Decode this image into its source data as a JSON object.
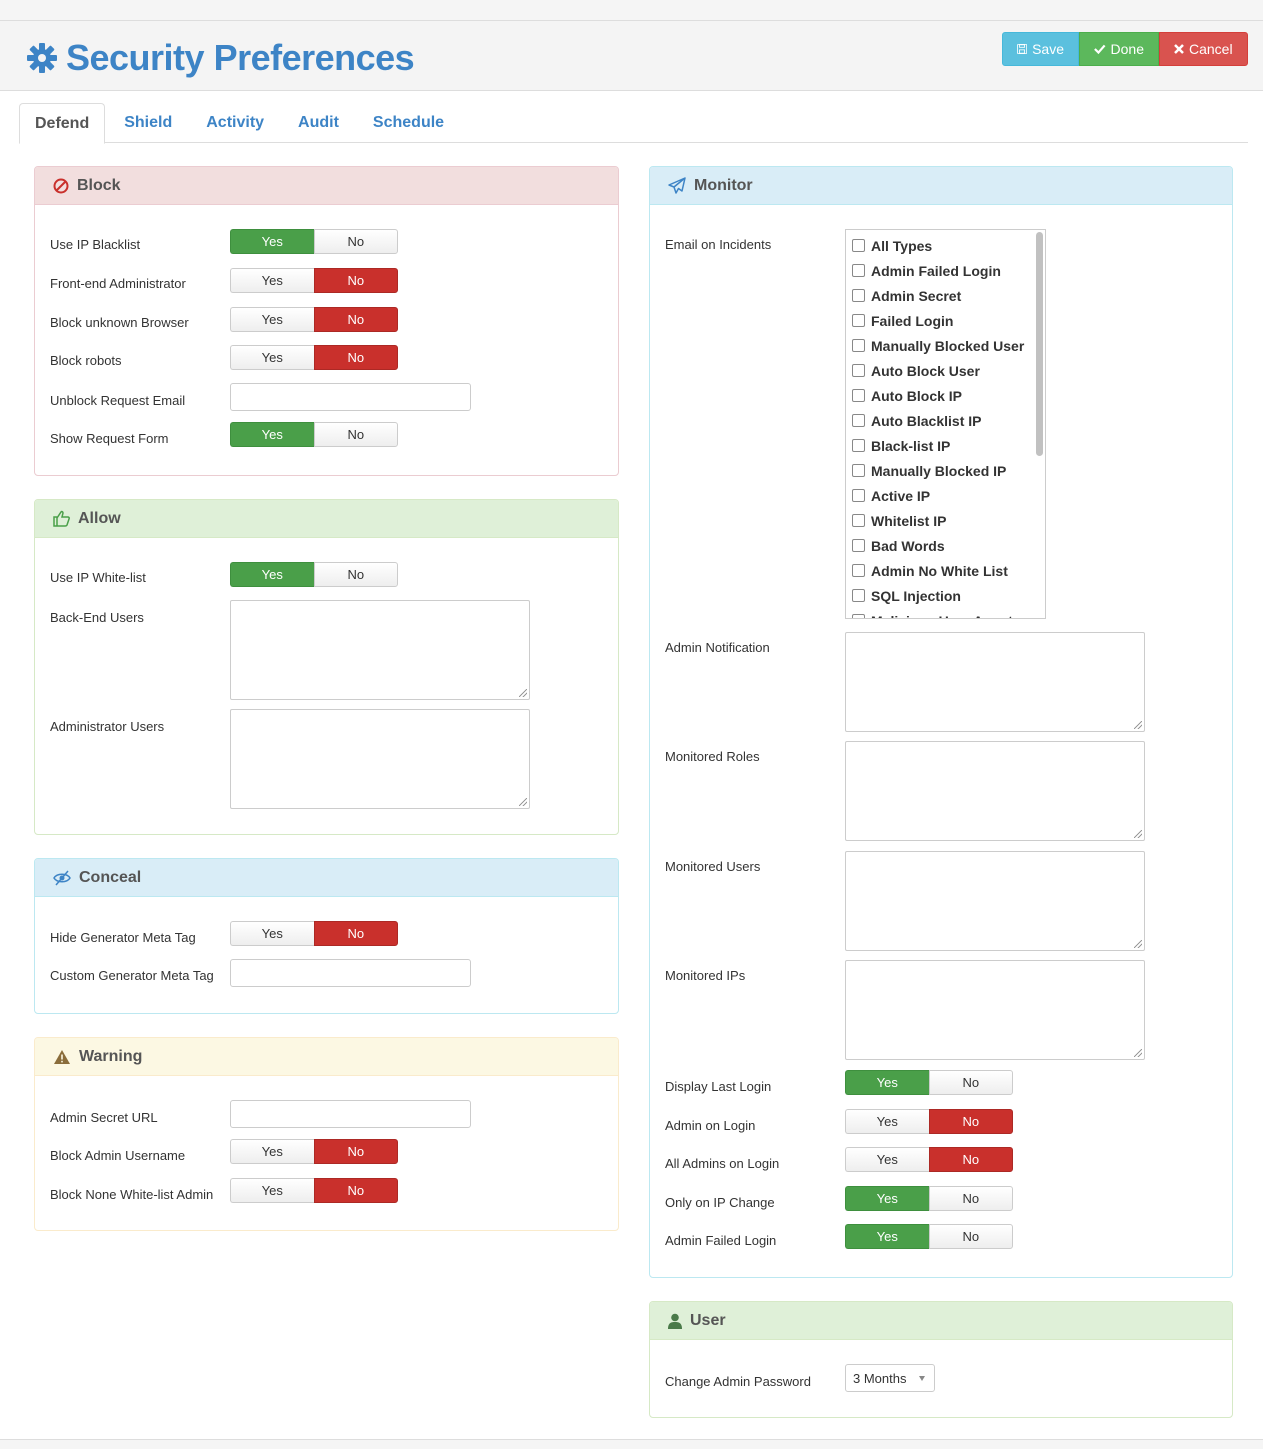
{
  "header": {
    "title": "Security Preferences",
    "save_label": "Save",
    "done_label": "Done",
    "cancel_label": "Cancel"
  },
  "tabs": [
    {
      "label": "Defend",
      "active": true
    },
    {
      "label": "Shield",
      "active": false
    },
    {
      "label": "Activity",
      "active": false
    },
    {
      "label": "Audit",
      "active": false
    },
    {
      "label": "Schedule",
      "active": false
    }
  ],
  "toggle_labels": {
    "yes": "Yes",
    "no": "No"
  },
  "block": {
    "title": "Block",
    "use_ip_blacklist": {
      "label": "Use IP Blacklist",
      "value": "Yes"
    },
    "frontend_admin": {
      "label": "Front-end Administrator",
      "value": "No"
    },
    "block_unknown_browser": {
      "label": "Block unknown Browser",
      "value": "No"
    },
    "block_robots": {
      "label": "Block robots",
      "value": "No"
    },
    "unblock_request_email": {
      "label": "Unblock Request Email",
      "value": ""
    },
    "show_request_form": {
      "label": "Show Request Form",
      "value": "Yes"
    }
  },
  "allow": {
    "title": "Allow",
    "use_ip_whitelist": {
      "label": "Use IP White-list",
      "value": "Yes"
    },
    "backend_users": {
      "label": "Back-End Users",
      "value": ""
    },
    "administrator_users": {
      "label": "Administrator Users",
      "value": ""
    }
  },
  "conceal": {
    "title": "Conceal",
    "hide_generator": {
      "label": "Hide Generator Meta Tag",
      "value": "No"
    },
    "custom_generator": {
      "label": "Custom Generator Meta Tag",
      "value": ""
    }
  },
  "warning": {
    "title": "Warning",
    "admin_secret_url": {
      "label": "Admin Secret URL",
      "value": ""
    },
    "block_admin_username": {
      "label": "Block Admin Username",
      "value": "No"
    },
    "block_none_whitelist_admin": {
      "label": "Block None White-list Admin",
      "value": "No"
    }
  },
  "monitor": {
    "title": "Monitor",
    "email_on_incidents": {
      "label": "Email on Incidents",
      "options": [
        "All Types",
        "Admin Failed Login",
        "Admin Secret",
        "Failed Login",
        "Manually Blocked User",
        "Auto Block User",
        "Auto Block IP",
        "Auto Blacklist IP",
        "Black-list IP",
        "Manually Blocked IP",
        "Active IP",
        "Whitelist IP",
        "Bad Words",
        "Admin No White List",
        "SQL Injection",
        "Malicious User Agent"
      ]
    },
    "admin_notification": {
      "label": "Admin Notification",
      "value": ""
    },
    "monitored_roles": {
      "label": "Monitored Roles",
      "value": ""
    },
    "monitored_users": {
      "label": "Monitored Users",
      "value": ""
    },
    "monitored_ips": {
      "label": "Monitored IPs",
      "value": ""
    },
    "display_last_login": {
      "label": "Display Last Login",
      "value": "Yes"
    },
    "admin_on_login": {
      "label": "Admin on Login",
      "value": "No"
    },
    "all_admins_on_login": {
      "label": "All Admins on Login",
      "value": "No"
    },
    "only_on_ip_change": {
      "label": "Only on IP Change",
      "value": "Yes"
    },
    "admin_failed_login": {
      "label": "Admin Failed Login",
      "value": "Yes"
    }
  },
  "user": {
    "title": "User",
    "change_admin_password": {
      "label": "Change Admin Password",
      "value": "3 Months"
    }
  },
  "colors": {
    "accent": "#3d84c6",
    "yes_active": "#4a9f49",
    "no_active": "#c9302c",
    "save": "#5bc0de",
    "done": "#5cb85c",
    "cancel": "#d9534f"
  }
}
